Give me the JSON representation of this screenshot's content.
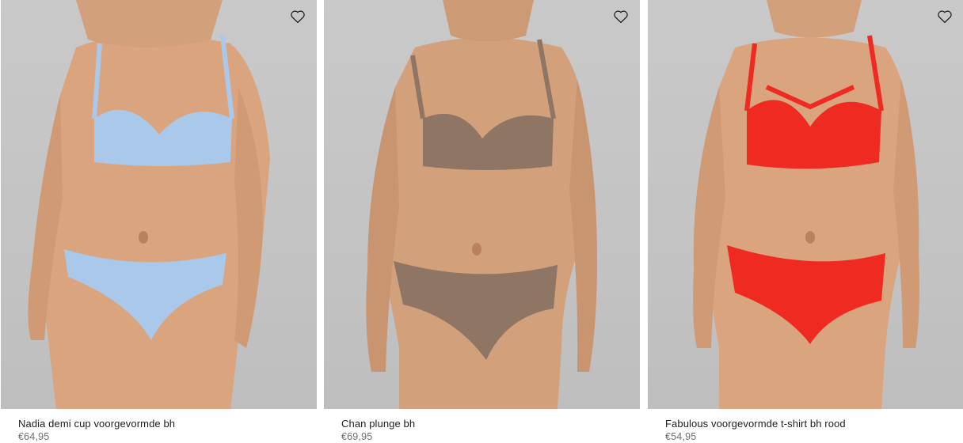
{
  "products": [
    {
      "name": "Nadia demi cup voorgevormde bh",
      "price": "€64,95",
      "garment_color": "#a9c8ea",
      "icon": "heart-outline-icon"
    },
    {
      "name": "Chan plunge bh",
      "price": "€69,95",
      "garment_color": "#8f7564",
      "icon": "heart-outline-icon"
    },
    {
      "name": "Fabulous voorgevormde t-shirt bh rood",
      "price": "€54,95",
      "garment_color": "#ef2b21",
      "icon": "heart-outline-icon"
    }
  ],
  "colors": {
    "skin": "#d9a47e",
    "skin_shadow": "#b9825d",
    "background": "#c6c6c6"
  }
}
